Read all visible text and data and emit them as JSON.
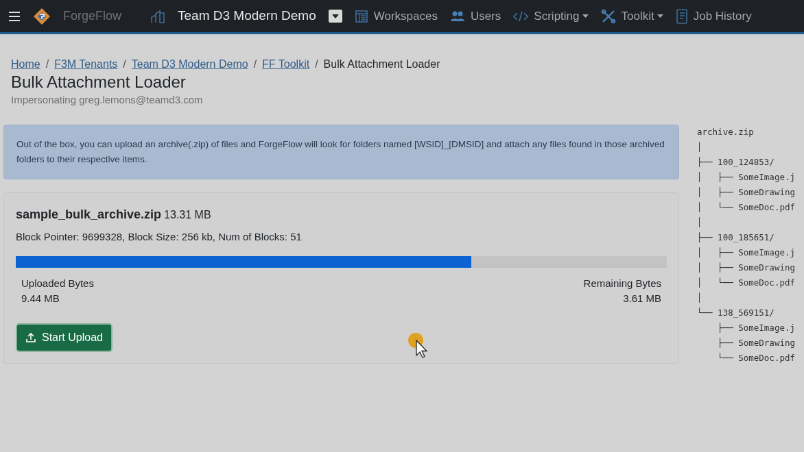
{
  "navbar": {
    "brand": "ForgeFlow",
    "tenant": "Team D3 Modern Demo",
    "items": [
      {
        "kind": "link",
        "label": "Workspaces"
      },
      {
        "kind": "link",
        "label": "Users"
      },
      {
        "kind": "dropdown",
        "label": "Scripting"
      },
      {
        "kind": "dropdown",
        "label": "Toolkit"
      },
      {
        "kind": "link",
        "label": "Job History"
      }
    ]
  },
  "breadcrumb": [
    {
      "label": "Home",
      "link": true
    },
    {
      "separator": "/",
      "label": "F3M Tenants",
      "link": true
    },
    {
      "separator": "/",
      "label": "Team D3 Modern Demo",
      "link": true
    },
    {
      "separator": "/",
      "label": "FF Toolkit",
      "link": true
    },
    {
      "separator": "/",
      "label": "Bulk Attachment Loader",
      "link": false
    }
  ],
  "page": {
    "title": "Bulk Attachment Loader",
    "subtitle": "Impersonating greg.lemons@teamd3.com"
  },
  "alert": "Out of the box, you can upload an archive(.zip) of files and ForgeFlow will look for folders named [WSID]_[DMSID] and attach any files found in those archived folders to their respective items.",
  "upload": {
    "file_name": "sample_bulk_archive.zip",
    "file_size": "13.31 MB",
    "details": "Block Pointer: 9699328, Block Size: 256 kb, Num of Blocks: 51",
    "level": 0.7,
    "uploaded_label": "Uploaded Bytes",
    "uploaded_value": "9.44 MB",
    "remaining_label": "Remaining Bytes",
    "remaining_value": "3.61 MB",
    "button": "Start Upload"
  },
  "archive_tree": [
    "archive.zip",
    "│",
    "├── 100_124853/",
    "│   ├── SomeImage.j",
    "│   ├── SomeDrawing",
    "│   └── SomeDoc.pdf",
    "│",
    "├── 100_185651/",
    "│   ├── SomeImage.j",
    "│   ├── SomeDrawing",
    "│   └── SomeDoc.pdf",
    "│",
    "└── 138_569151/",
    "    ├── SomeImage.j",
    "    ├── SomeDrawing",
    "    └── SomeDoc.pdf"
  ]
}
